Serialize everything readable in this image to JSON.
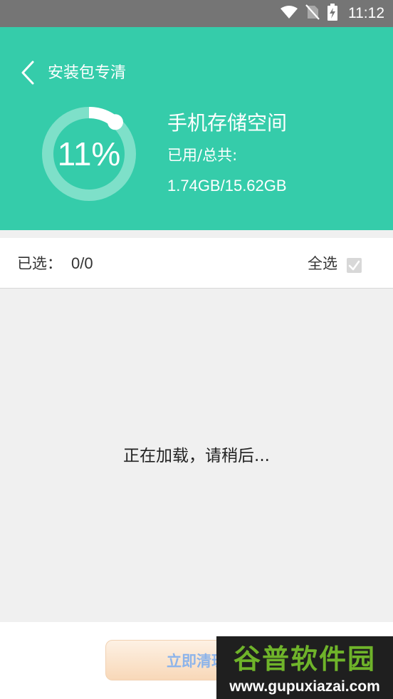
{
  "status_bar": {
    "time": "11:12"
  },
  "header": {
    "title": "安装包专清",
    "usage_percent": "11%",
    "usage_fraction": 0.11,
    "storage_title": "手机存储空间",
    "storage_label": "已用/总共:",
    "storage_value": "1.74GB/15.62GB"
  },
  "selection": {
    "selected_label": "已选：",
    "selected_count": "0/0",
    "select_all_label": "全选",
    "select_all_checked": true
  },
  "content": {
    "loading_text": "正在加载，请稍后..."
  },
  "actions": {
    "clean_label": "立即清理"
  },
  "watermark": {
    "logo": "谷普软件园",
    "url": "www.gupuxiazai.com"
  },
  "colors": {
    "accent": "#35ccaa",
    "status_bar": "#757575",
    "background": "#f0f0f0"
  }
}
